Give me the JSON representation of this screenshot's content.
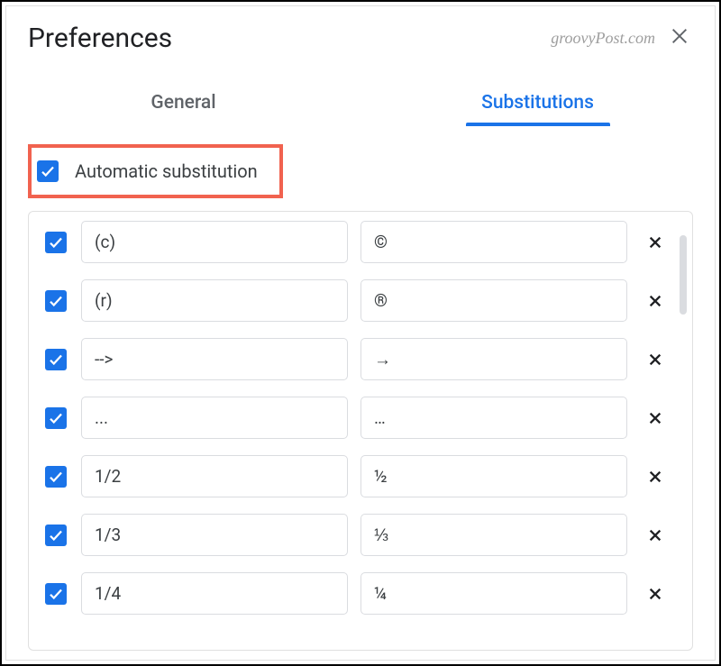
{
  "header": {
    "title": "Preferences",
    "watermark": "groovyPost.com"
  },
  "tabs": {
    "general": "General",
    "substitutions": "Substitutions"
  },
  "autoSub": {
    "label": "Automatic substitution"
  },
  "rows": [
    {
      "from": "(c)",
      "to": "©"
    },
    {
      "from": "(r)",
      "to": "®"
    },
    {
      "from": "-->",
      "to": "→"
    },
    {
      "from": "...",
      "to": "…"
    },
    {
      "from": "1/2",
      "to": "½"
    },
    {
      "from": "1/3",
      "to": "⅓"
    },
    {
      "from": "1/4",
      "to": "¼"
    }
  ]
}
